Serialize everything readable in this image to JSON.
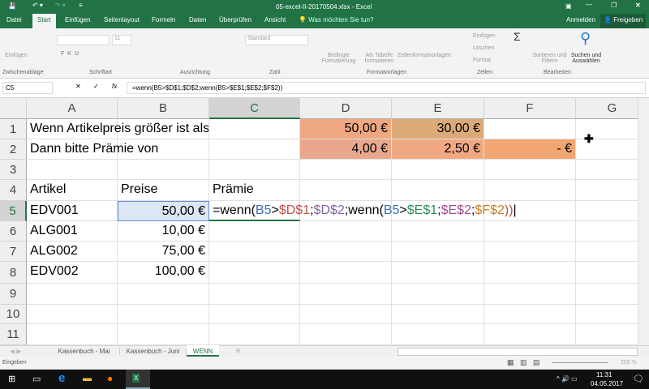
{
  "title": "05-excel-II-20170504.xlsx - Excel",
  "tabs": [
    "Datei",
    "Start",
    "Einfügen",
    "Seitenlayout",
    "Formeln",
    "Daten",
    "Überprüfen",
    "Ansicht"
  ],
  "tell_me": "Was möchten Sie tun?",
  "sign_in": "Anmelden",
  "share": "Freigeben",
  "ribbon": {
    "paste": "Einfügen",
    "clipboard": "Zwischenablage",
    "font_size": "11",
    "font": "Schriftart",
    "alignment": "Ausrichtung",
    "number_format": "Standard",
    "number": "Zahl",
    "cond_format": "Bedingte Formatierung",
    "as_table": "Als Tabelle formatieren",
    "cell_styles": "Zellenformatvorlagen",
    "styles": "Formatvorlagen",
    "insert": "Einfügen",
    "delete": "Löschen",
    "format": "Format",
    "cells": "Zellen",
    "sort": "Sortieren und Filtern",
    "find": "Suchen und Auswählen",
    "editing": "Bearbeiten"
  },
  "namebox": "C5",
  "formula": "=wenn(B5>$D$1;$D$2;wenn(B5>$E$1;$E$2;$F$2))",
  "columns": [
    "A",
    "B",
    "C",
    "D",
    "E",
    "F",
    "G"
  ],
  "rows": [
    "1",
    "2",
    "3",
    "4",
    "5",
    "6",
    "7",
    "8",
    "9",
    "10",
    "11"
  ],
  "cells": {
    "A1": "Wenn Artikelpreis größer ist als",
    "A2": "Dann bitte Prämie von",
    "D1": "50,00 €",
    "E1": "30,00 €",
    "D2": "4,00 €",
    "E2": "2,50 €",
    "F2": "-    €",
    "A4": "Artikel",
    "B4": "Preise",
    "C4": "Prämie",
    "A5": "EDV001",
    "B5": "50,00 €",
    "A6": "ALG001",
    "B6": "10,00 €",
    "A7": "ALG002",
    "B7": "75,00 €",
    "A8": "EDV002",
    "B8": "100,00 €"
  },
  "edit_parts": [
    {
      "t": "=wenn(",
      "c": "#000000"
    },
    {
      "t": "B5",
      "c": "#3b6fb6"
    },
    {
      "t": ">",
      "c": "#000000"
    },
    {
      "t": "$D$1",
      "c": "#c0504d"
    },
    {
      "t": ";",
      "c": "#000000"
    },
    {
      "t": "$D$2",
      "c": "#8064a2"
    },
    {
      "t": ";wenn(",
      "c": "#000000"
    },
    {
      "t": "B5",
      "c": "#3b6fb6"
    },
    {
      "t": ">",
      "c": "#000000"
    },
    {
      "t": "$E$1",
      "c": "#2e8b57"
    },
    {
      "t": ";",
      "c": "#000000"
    },
    {
      "t": "$E$2",
      "c": "#a0508f"
    },
    {
      "t": ";",
      "c": "#000000"
    },
    {
      "t": "$F$2",
      "c": "#c77c1e"
    },
    {
      "t": "))",
      "c": "#c0504d"
    }
  ],
  "sheet_tabs": [
    "Kassenbuch - Mai",
    "Kassenbuch - Juni",
    "WENN"
  ],
  "status": "Eingeben",
  "zoom": "205 %",
  "clock": {
    "time": "11:31",
    "date": "04.05.2017"
  }
}
